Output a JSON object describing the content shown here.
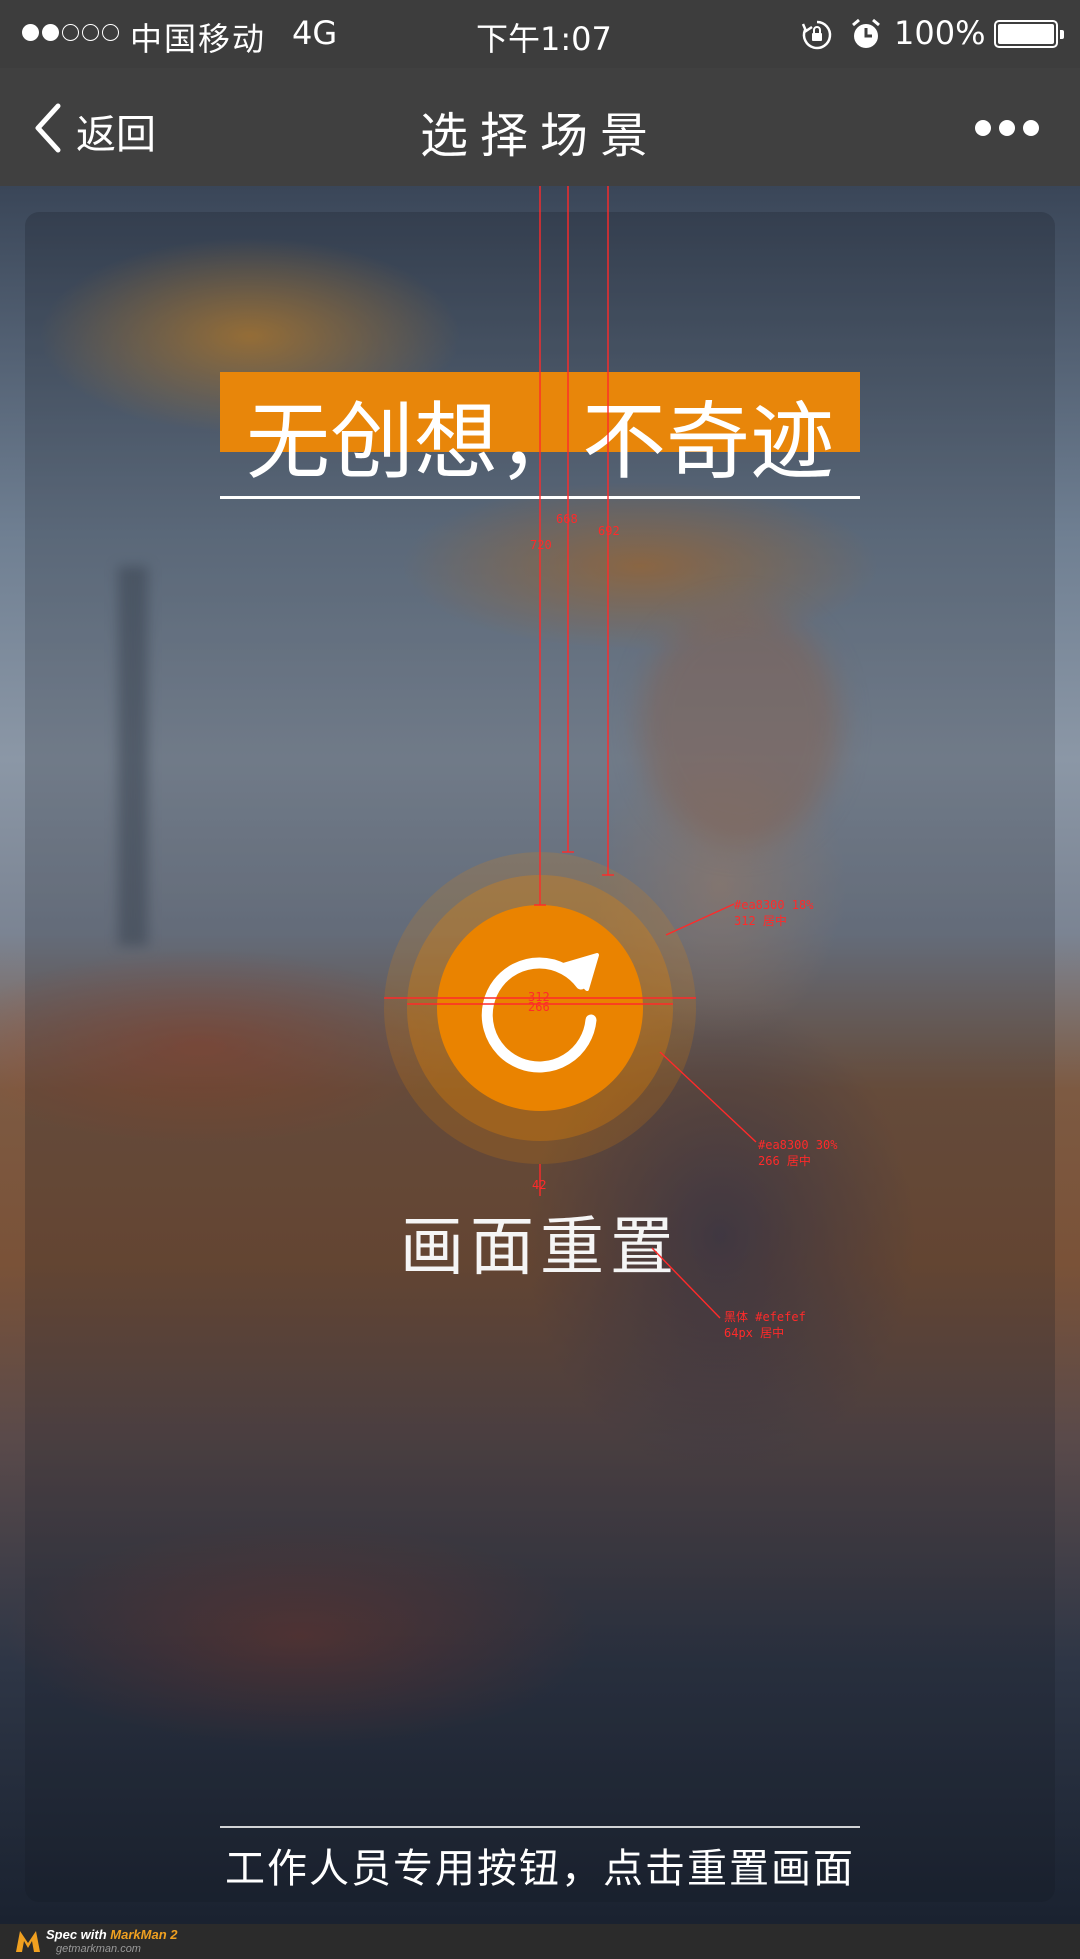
{
  "status_bar": {
    "carrier": "中国移动",
    "network": "4G",
    "time": "下午1:07",
    "battery": "100%",
    "signal_strength": 2,
    "signal_max": 5,
    "icons": [
      "rotation-lock-icon",
      "alarm-icon",
      "battery-icon"
    ]
  },
  "nav": {
    "back_label": "返回",
    "title": "选择场景",
    "back_icon": "chevron-left-icon",
    "more_icon": "more-dots-icon"
  },
  "headline": {
    "text": "无创想，不奇迹"
  },
  "reset": {
    "icon": "refresh-icon",
    "label": "画面重置"
  },
  "annotations": {
    "dist_top_1": "668",
    "dist_top_2": "720",
    "dist_top_3": "692",
    "outer_size": "312",
    "inner_size": "266",
    "label_gap": "42",
    "outer_halo_line1": "#ea8300 18%",
    "outer_halo_line2": "312 居中",
    "inner_halo_line1": "#ea8300 30%",
    "inner_halo_line2": "266 居中",
    "label_font_line1": "黑体 #efefef",
    "label_font_line2": "64px 居中"
  },
  "footer": {
    "hint": "工作人员专用按钮，点击重置画面"
  },
  "watermark": {
    "prefix": "Spec with ",
    "brand": "MarkMan 2",
    "site": "getmarkman.com"
  },
  "colors": {
    "accent": "#ea8300",
    "headline_bar": "#e8860a",
    "status_bar": "#3d3d3d",
    "nav_bar": "#404040",
    "annotation": "#ff2a2a"
  }
}
